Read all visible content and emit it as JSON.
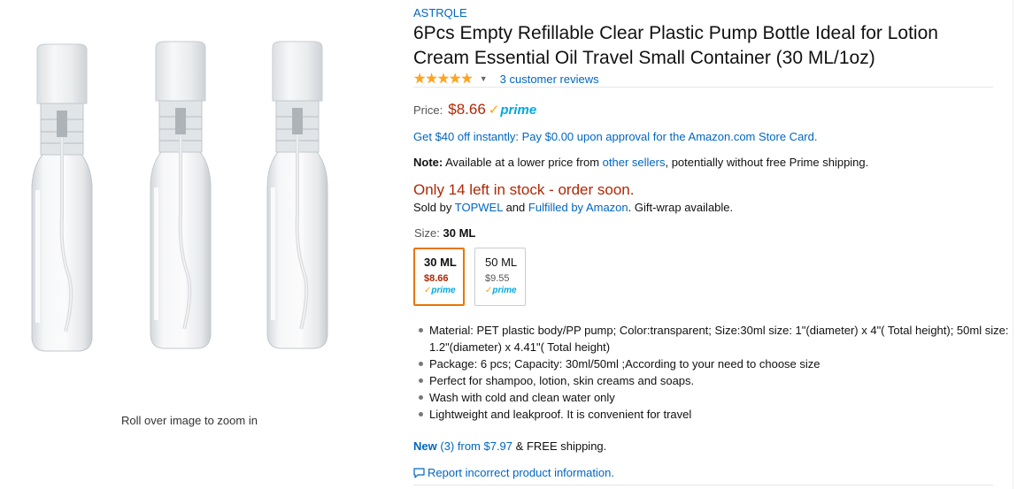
{
  "image": {
    "zoom_hint": "Roll over image to zoom in",
    "bottle_count_shown": 3
  },
  "product": {
    "brand": "ASTRQLE",
    "title": "6Pcs Empty Refillable Clear Plastic Pump Bottle Ideal for Lotion Cream Essential Oil Travel Small Container (30 ML/1oz)",
    "rating_stars": 5,
    "reviews_link": "3 customer reviews"
  },
  "price": {
    "label": "Price:",
    "value": "$8.66",
    "prime_label": "prime"
  },
  "promo": {
    "text": "Get $40 off instantly: Pay $0.00 upon approval for the Amazon.com Store Card."
  },
  "note": {
    "label": "Note:",
    "text_before": "Available at a lower price from",
    "link": "other sellers",
    "text_after": ", potentially without free Prime shipping."
  },
  "stock": {
    "text": "Only 14 left in stock - order soon."
  },
  "sold_by": {
    "prefix": "Sold by",
    "seller": "TOPWEL",
    "and": "and",
    "fulfilled": "Fulfilled by Amazon",
    "suffix": ". Gift-wrap available."
  },
  "size": {
    "label": "Size:",
    "selected": "30 ML",
    "options": [
      {
        "name": "30 ML",
        "price": "$8.66",
        "prime": "prime",
        "selected": true
      },
      {
        "name": "50 ML",
        "price": "$9.55",
        "prime": "prime",
        "selected": false
      }
    ]
  },
  "bullets": [
    "Material: PET plastic body/PP pump; Color:transparent; Size:30ml size: 1\"(diameter) x 4\"( Total height); 50ml size: 1.2\"(diameter) x 4.41\"( Total height)",
    "Package: 6 pcs; Capacity: 30ml/50ml ;According to your need to choose size",
    "Perfect for shampoo, lotion, skin creams and soaps.",
    "Wash with cold and clean water only",
    "Lightweight and leakproof. It is convenient for travel"
  ],
  "offers": {
    "new_label": "New",
    "new_count": "(3)",
    "from_text": "from $7.97",
    "shipping_text": "& FREE shipping."
  },
  "report": {
    "text": "Report incorrect product information."
  },
  "colors": {
    "link": "#0066c0",
    "price": "#b12704",
    "star": "#ffa41c",
    "prime": "#00a8e1",
    "swatch_selected": "#e77600"
  }
}
